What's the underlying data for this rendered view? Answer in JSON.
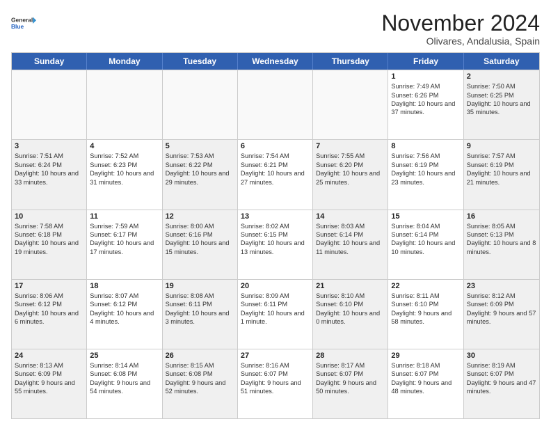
{
  "logo": {
    "general": "General",
    "blue": "Blue"
  },
  "title": "November 2024",
  "location": "Olivares, Andalusia, Spain",
  "header_days": [
    "Sunday",
    "Monday",
    "Tuesday",
    "Wednesday",
    "Thursday",
    "Friday",
    "Saturday"
  ],
  "weeks": [
    [
      {
        "day": "",
        "text": "",
        "empty": true
      },
      {
        "day": "",
        "text": "",
        "empty": true
      },
      {
        "day": "",
        "text": "",
        "empty": true
      },
      {
        "day": "",
        "text": "",
        "empty": true
      },
      {
        "day": "",
        "text": "",
        "empty": true
      },
      {
        "day": "1",
        "text": "Sunrise: 7:49 AM\nSunset: 6:26 PM\nDaylight: 10 hours and 37 minutes."
      },
      {
        "day": "2",
        "text": "Sunrise: 7:50 AM\nSunset: 6:25 PM\nDaylight: 10 hours and 35 minutes.",
        "shaded": true
      }
    ],
    [
      {
        "day": "3",
        "text": "Sunrise: 7:51 AM\nSunset: 6:24 PM\nDaylight: 10 hours and 33 minutes.",
        "shaded": true
      },
      {
        "day": "4",
        "text": "Sunrise: 7:52 AM\nSunset: 6:23 PM\nDaylight: 10 hours and 31 minutes."
      },
      {
        "day": "5",
        "text": "Sunrise: 7:53 AM\nSunset: 6:22 PM\nDaylight: 10 hours and 29 minutes.",
        "shaded": true
      },
      {
        "day": "6",
        "text": "Sunrise: 7:54 AM\nSunset: 6:21 PM\nDaylight: 10 hours and 27 minutes."
      },
      {
        "day": "7",
        "text": "Sunrise: 7:55 AM\nSunset: 6:20 PM\nDaylight: 10 hours and 25 minutes.",
        "shaded": true
      },
      {
        "day": "8",
        "text": "Sunrise: 7:56 AM\nSunset: 6:19 PM\nDaylight: 10 hours and 23 minutes."
      },
      {
        "day": "9",
        "text": "Sunrise: 7:57 AM\nSunset: 6:19 PM\nDaylight: 10 hours and 21 minutes.",
        "shaded": true
      }
    ],
    [
      {
        "day": "10",
        "text": "Sunrise: 7:58 AM\nSunset: 6:18 PM\nDaylight: 10 hours and 19 minutes.",
        "shaded": true
      },
      {
        "day": "11",
        "text": "Sunrise: 7:59 AM\nSunset: 6:17 PM\nDaylight: 10 hours and 17 minutes."
      },
      {
        "day": "12",
        "text": "Sunrise: 8:00 AM\nSunset: 6:16 PM\nDaylight: 10 hours and 15 minutes.",
        "shaded": true
      },
      {
        "day": "13",
        "text": "Sunrise: 8:02 AM\nSunset: 6:15 PM\nDaylight: 10 hours and 13 minutes."
      },
      {
        "day": "14",
        "text": "Sunrise: 8:03 AM\nSunset: 6:14 PM\nDaylight: 10 hours and 11 minutes.",
        "shaded": true
      },
      {
        "day": "15",
        "text": "Sunrise: 8:04 AM\nSunset: 6:14 PM\nDaylight: 10 hours and 10 minutes."
      },
      {
        "day": "16",
        "text": "Sunrise: 8:05 AM\nSunset: 6:13 PM\nDaylight: 10 hours and 8 minutes.",
        "shaded": true
      }
    ],
    [
      {
        "day": "17",
        "text": "Sunrise: 8:06 AM\nSunset: 6:12 PM\nDaylight: 10 hours and 6 minutes.",
        "shaded": true
      },
      {
        "day": "18",
        "text": "Sunrise: 8:07 AM\nSunset: 6:12 PM\nDaylight: 10 hours and 4 minutes."
      },
      {
        "day": "19",
        "text": "Sunrise: 8:08 AM\nSunset: 6:11 PM\nDaylight: 10 hours and 3 minutes.",
        "shaded": true
      },
      {
        "day": "20",
        "text": "Sunrise: 8:09 AM\nSunset: 6:11 PM\nDaylight: 10 hours and 1 minute."
      },
      {
        "day": "21",
        "text": "Sunrise: 8:10 AM\nSunset: 6:10 PM\nDaylight: 10 hours and 0 minutes.",
        "shaded": true
      },
      {
        "day": "22",
        "text": "Sunrise: 8:11 AM\nSunset: 6:10 PM\nDaylight: 9 hours and 58 minutes."
      },
      {
        "day": "23",
        "text": "Sunrise: 8:12 AM\nSunset: 6:09 PM\nDaylight: 9 hours and 57 minutes.",
        "shaded": true
      }
    ],
    [
      {
        "day": "24",
        "text": "Sunrise: 8:13 AM\nSunset: 6:09 PM\nDaylight: 9 hours and 55 minutes.",
        "shaded": true
      },
      {
        "day": "25",
        "text": "Sunrise: 8:14 AM\nSunset: 6:08 PM\nDaylight: 9 hours and 54 minutes."
      },
      {
        "day": "26",
        "text": "Sunrise: 8:15 AM\nSunset: 6:08 PM\nDaylight: 9 hours and 52 minutes.",
        "shaded": true
      },
      {
        "day": "27",
        "text": "Sunrise: 8:16 AM\nSunset: 6:07 PM\nDaylight: 9 hours and 51 minutes."
      },
      {
        "day": "28",
        "text": "Sunrise: 8:17 AM\nSunset: 6:07 PM\nDaylight: 9 hours and 50 minutes.",
        "shaded": true
      },
      {
        "day": "29",
        "text": "Sunrise: 8:18 AM\nSunset: 6:07 PM\nDaylight: 9 hours and 48 minutes."
      },
      {
        "day": "30",
        "text": "Sunrise: 8:19 AM\nSunset: 6:07 PM\nDaylight: 9 hours and 47 minutes.",
        "shaded": true
      }
    ]
  ]
}
